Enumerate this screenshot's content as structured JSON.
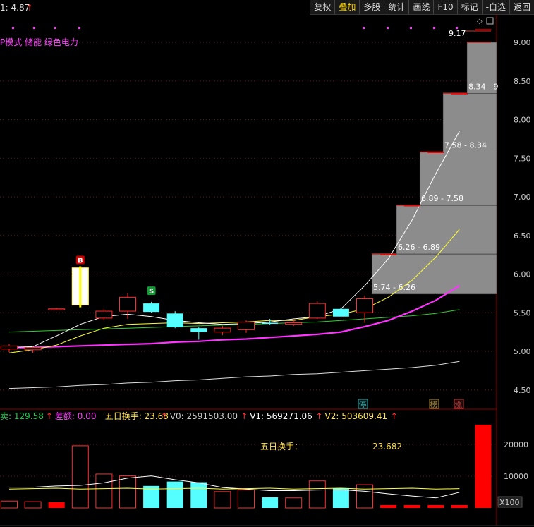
{
  "toolbar": {
    "items": [
      "复权",
      "叠加",
      "多股",
      "统计",
      "画线",
      "F10",
      "标记",
      "-自选",
      "返回"
    ],
    "active_index": 1
  },
  "price_header": {
    "label": "1: 4.87",
    "arrow": "↑"
  },
  "indicator_names": "P模式 储能 绿色电力",
  "y_axis_labels": [
    "9.00",
    "8.50",
    "8.00",
    "7.50",
    "7.00",
    "6.50",
    "6.00",
    "5.50",
    "5.00",
    "4.50"
  ],
  "markers": {
    "buy": "B",
    "sell": "S",
    "peak": "9.17",
    "bottom": [
      "停",
      "榜",
      "涨"
    ]
  },
  "chip_ranges": [
    "5.74 - 6.26",
    "6.26 - 6.89",
    "6.89 - 7.58",
    "7.58 - 8.34",
    "8.34 - 9"
  ],
  "volume_header": [
    {
      "label": "卖: 129.58",
      "arrow": "↑",
      "color": "#22c84a"
    },
    {
      "label": "差额: 0.00",
      "arrow": "",
      "color": "#ff44ff"
    },
    {
      "label": "五日换手: 23.68",
      "arrow": "↑",
      "color": "#ffe14d"
    },
    {
      "label": "V0: 2591503.00",
      "arrow": "↑",
      "color": "#cccccc"
    },
    {
      "label": "V1: 569271.06",
      "arrow": "↑",
      "color": "#ffffff"
    },
    {
      "label": "V2: 503609.41",
      "arrow": "↑",
      "color": "#ffe14d"
    }
  ],
  "volume_info": {
    "label": "五日换手：",
    "value": "23.682"
  },
  "volume_axis": [
    "20000",
    "10000",
    "X100"
  ],
  "colors": {
    "up": "#ff2d2d",
    "down": "#55ffff",
    "limit": "#ff0000",
    "ma5": "#ffffff",
    "ma10": "#ffff33",
    "ma20": "#ff33ff",
    "ma60": "#33cc33",
    "chip": "#8c8c8c"
  },
  "chart_data": {
    "type": "candlestick",
    "ylim": [
      4.3,
      9.3
    ],
    "candles": [
      {
        "o": 5.03,
        "h": 5.09,
        "l": 4.99,
        "c": 5.07
      },
      {
        "o": 5.02,
        "h": 5.06,
        "l": 4.98,
        "c": 5.05
      },
      {
        "o": 5.55,
        "h": 5.56,
        "l": 5.55,
        "c": 5.55
      },
      {
        "o": 5.6,
        "h": 6.1,
        "l": 5.57,
        "c": 6.08
      },
      {
        "o": 5.43,
        "h": 5.55,
        "l": 5.4,
        "c": 5.52
      },
      {
        "o": 5.52,
        "h": 5.75,
        "l": 5.42,
        "c": 5.7
      },
      {
        "o": 5.62,
        "h": 5.64,
        "l": 5.5,
        "c": 5.51
      },
      {
        "o": 5.49,
        "h": 5.52,
        "l": 5.3,
        "c": 5.31
      },
      {
        "o": 5.3,
        "h": 5.32,
        "l": 5.15,
        "c": 5.25
      },
      {
        "o": 5.25,
        "h": 5.33,
        "l": 5.21,
        "c": 5.3
      },
      {
        "o": 5.28,
        "h": 5.4,
        "l": 5.24,
        "c": 5.38
      },
      {
        "o": 5.37,
        "h": 5.42,
        "l": 5.34,
        "c": 5.36
      },
      {
        "o": 5.35,
        "h": 5.41,
        "l": 5.33,
        "c": 5.37
      },
      {
        "o": 5.43,
        "h": 5.65,
        "l": 5.42,
        "c": 5.62
      },
      {
        "o": 5.55,
        "h": 5.56,
        "l": 5.44,
        "c": 5.45
      },
      {
        "o": 5.5,
        "h": 5.72,
        "l": 5.37,
        "c": 5.68
      },
      {
        "o": 6.26,
        "h": 6.26,
        "l": 6.26,
        "c": 6.26
      },
      {
        "o": 6.89,
        "h": 6.89,
        "l": 6.89,
        "c": 6.89
      },
      {
        "o": 7.58,
        "h": 7.58,
        "l": 7.58,
        "c": 7.58
      },
      {
        "o": 8.34,
        "h": 8.34,
        "l": 8.34,
        "c": 8.34
      },
      {
        "o": 9.17,
        "h": 9.17,
        "l": 9.17,
        "c": 9.17
      }
    ],
    "ma5": [
      5.05,
      5.06,
      5.2,
      5.35,
      5.45,
      5.48,
      5.45,
      5.4,
      5.37,
      5.35,
      5.36,
      5.38,
      5.42,
      5.45,
      5.55,
      5.85,
      6.2,
      6.7,
      7.3,
      7.85
    ],
    "ma10": [
      4.98,
      5.02,
      5.08,
      5.2,
      5.3,
      5.35,
      5.36,
      5.37,
      5.36,
      5.37,
      5.38,
      5.4,
      5.4,
      5.45,
      5.48,
      5.55,
      5.7,
      5.92,
      6.22,
      6.58
    ],
    "ma20": [
      5.05,
      5.05,
      5.06,
      5.07,
      5.08,
      5.09,
      5.1,
      5.12,
      5.13,
      5.15,
      5.16,
      5.18,
      5.2,
      5.22,
      5.25,
      5.32,
      5.4,
      5.52,
      5.66,
      5.85
    ],
    "ma60": [
      5.25,
      5.26,
      5.27,
      5.28,
      5.29,
      5.3,
      5.31,
      5.32,
      5.33,
      5.34,
      5.35,
      5.36,
      5.37,
      5.38,
      5.4,
      5.42,
      5.44,
      5.46,
      5.49,
      5.54
    ],
    "ma120": [
      4.52,
      4.53,
      4.54,
      4.56,
      4.57,
      4.59,
      4.6,
      4.62,
      4.63,
      4.65,
      4.67,
      4.68,
      4.7,
      4.71,
      4.73,
      4.75,
      4.77,
      4.79,
      4.82,
      4.87
    ],
    "volume": [
      2.2,
      2.0,
      1.8,
      19.8,
      10.8,
      10.2,
      7.0,
      8.4,
      8.2,
      5.2,
      5.8,
      3.4,
      3.2,
      8.6,
      6.2,
      7.4,
      0.9,
      0.9,
      0.9,
      0.9,
      26.5
    ],
    "volume_ma": [
      6.6,
      6.6,
      7.0,
      7.2,
      8.0,
      9.5,
      10.2,
      9.0,
      8.0,
      6.5,
      6.0,
      5.5,
      5.5,
      5.7,
      5.8,
      5.3,
      4.5,
      3.8,
      3.2,
      5.0
    ],
    "chip_profile": [
      {
        "from": 5.74,
        "to": 6.26
      },
      {
        "from": 6.26,
        "to": 6.89
      },
      {
        "from": 6.89,
        "to": 7.58
      },
      {
        "from": 7.58,
        "to": 8.34
      },
      {
        "from": 8.34,
        "to": 9.0
      }
    ]
  }
}
